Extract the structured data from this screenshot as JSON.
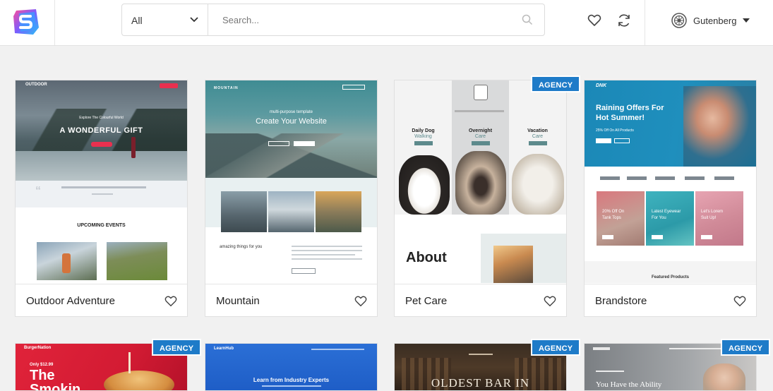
{
  "header": {
    "category_value": "All",
    "search_placeholder": "Search...",
    "builder_label": "Gutenberg"
  },
  "badge_label": "AGENCY",
  "cards": [
    {
      "title": "Outdoor Adventure",
      "preview": {
        "logo": "OUTDOOR",
        "kicker": "Explore The Colourful World",
        "headline": "A WONDERFUL GIFT",
        "section": "UPCOMING EVENTS"
      }
    },
    {
      "title": "Mountain",
      "preview": {
        "logo": "MOUNTAIN",
        "kicker": "multi-purpose template",
        "headline": "Create Your Website",
        "text": "amazing things for you"
      }
    },
    {
      "title": "Pet Care",
      "preview": {
        "cols": [
          {
            "line1": "Daily Dog",
            "line2": "Walking"
          },
          {
            "line1": "Overnight",
            "line2": "Care"
          },
          {
            "line1": "Vacation",
            "line2": "Care"
          }
        ],
        "about": "About"
      }
    },
    {
      "title": "Brandstore",
      "preview": {
        "logo": "DNK",
        "headline_1": "Raining Offers For",
        "headline_2": "Hot Summer!",
        "sub": "25% Off On All Products",
        "tiles": [
          {
            "line1": "20% Off On",
            "line2": "Tank Tops"
          },
          {
            "line1": "Latest Eyewear",
            "line2": "For You"
          },
          {
            "line1": "Let's Lorem",
            "line2": "Suit Up!"
          }
        ],
        "featured": "Featured Products"
      }
    },
    {
      "preview": {
        "logo": "BurgerNation",
        "price": "Only $12.99",
        "headline_1": "The",
        "headline_2": "Smokin"
      }
    },
    {
      "preview": {
        "logo": "LearnHub",
        "headline": "Learn from Industry Experts"
      }
    },
    {
      "preview": {
        "headline": "OLDEST BAR IN"
      }
    },
    {
      "preview": {
        "headline": "You Have the Ability"
      }
    }
  ],
  "colors": {
    "badge": "#1e7bc8",
    "page_bg": "#f1f1f1"
  },
  "icons": [
    "logo-icon",
    "chevron-down-icon",
    "search-icon",
    "heart-icon",
    "sync-icon",
    "wordpress-icon",
    "caret-down-icon"
  ]
}
